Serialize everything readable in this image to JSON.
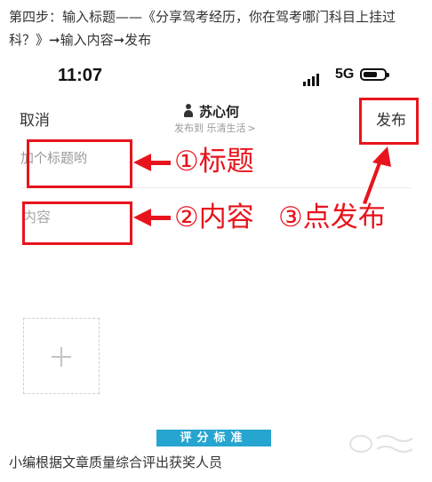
{
  "intro_text": "第四步：输入标题——《分享驾考经历，你在驾考哪门科目上挂过科？》➞输入内容➞发布",
  "status_bar": {
    "time": "11:07",
    "network": "5G",
    "battery_level_percent": 70
  },
  "nav": {
    "cancel_label": "取消",
    "author_name": "苏心何",
    "publish_to": "发布到 乐清生活",
    "publish_to_chevron": ">",
    "publish_label": "发布"
  },
  "editor": {
    "title_placeholder": "加个标题哟",
    "content_placeholder": "内容",
    "add_button_icon": "plus-icon"
  },
  "annotations": {
    "step1": "①标题",
    "step2": "②内容",
    "step3": "③点发布",
    "color": "#e8141d"
  },
  "footer": {
    "banner": "评分标准",
    "banner_color": "#26a5d0",
    "caption": "小编根据文章质量综合评出获奖人员"
  }
}
